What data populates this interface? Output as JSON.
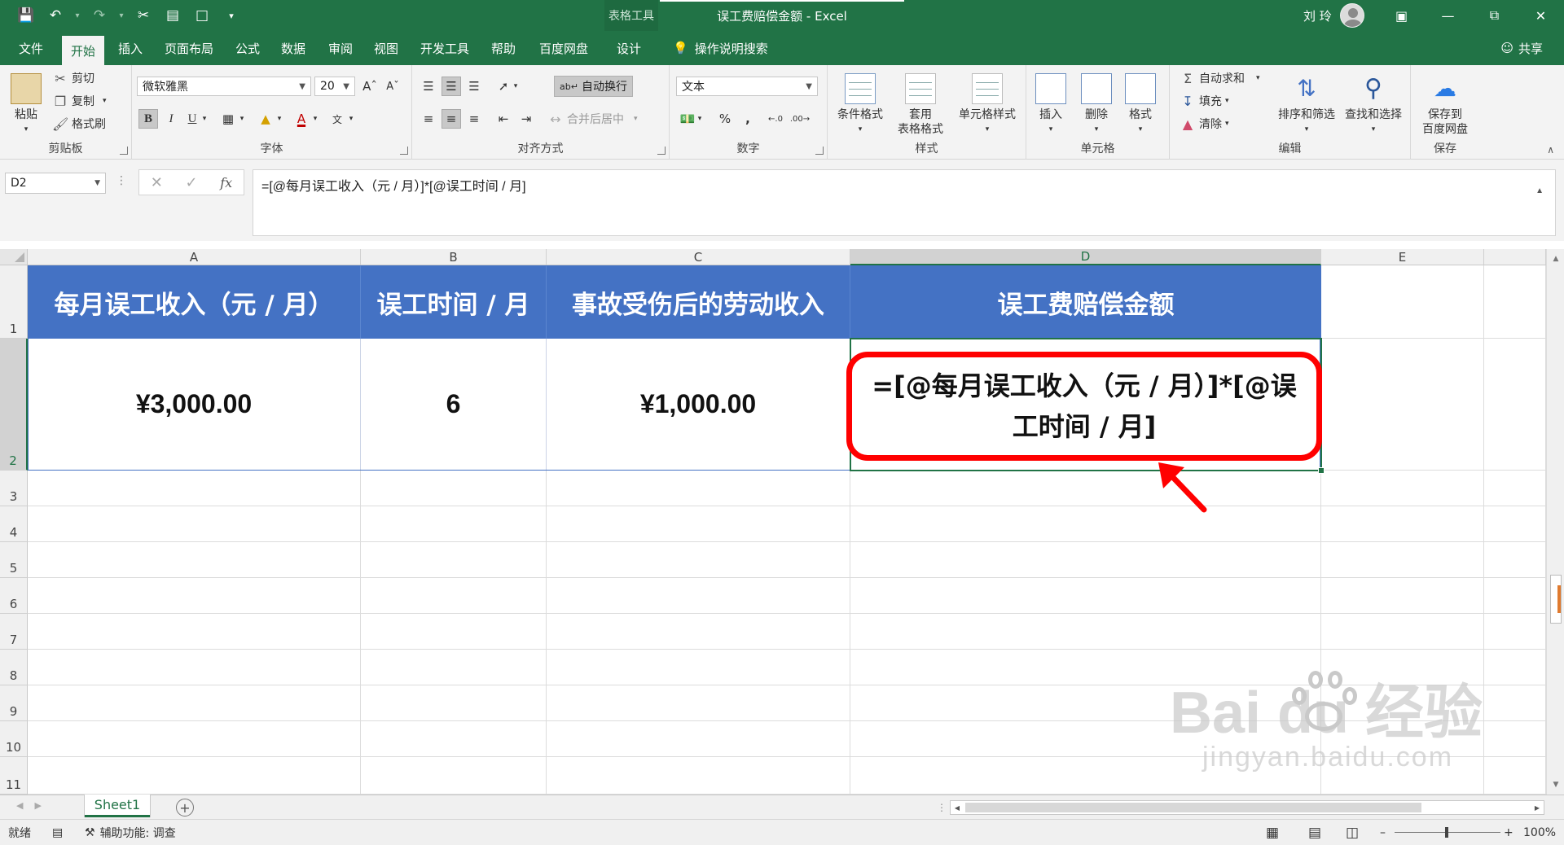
{
  "titlebar": {
    "context_tools": "表格工具",
    "title": "误工费赔偿金额 - Excel",
    "user": "刘 玲"
  },
  "tabs": [
    "文件",
    "开始",
    "插入",
    "页面布局",
    "公式",
    "数据",
    "审阅",
    "视图",
    "开发工具",
    "帮助",
    "百度网盘",
    "设计"
  ],
  "tellme": "操作说明搜索",
  "share": "共享",
  "ribbon": {
    "clipboard": {
      "paste": "粘贴",
      "cut": "剪切",
      "copy": "复制",
      "format_painter": "格式刷",
      "label": "剪贴板"
    },
    "font": {
      "name": "微软雅黑",
      "size": "20",
      "label": "字体"
    },
    "alignment": {
      "wrap": "自动换行",
      "merge": "合并后居中",
      "label": "对齐方式"
    },
    "number": {
      "format": "文本",
      "label": "数字"
    },
    "styles": {
      "conditional": "条件格式",
      "table1": "套用",
      "table2": "表格格式",
      "cell_styles": "单元格样式",
      "label": "样式"
    },
    "cells": {
      "insert": "插入",
      "delete": "删除",
      "format": "格式",
      "label": "单元格"
    },
    "editing": {
      "autosum": "自动求和",
      "fill": "填充",
      "clear": "清除",
      "sort": "排序和筛选",
      "find": "查找和选择",
      "label": "编辑"
    },
    "save": {
      "btn1": "保存到",
      "btn2": "百度网盘",
      "label": "保存"
    }
  },
  "formula_bar": {
    "name_box": "D2",
    "formula": "=[@每月误工收入（元 / 月）]*[@误工时间 / 月]"
  },
  "columns": [
    "A",
    "B",
    "C",
    "D",
    "E"
  ],
  "rows": [
    "1",
    "2",
    "3",
    "4",
    "5",
    "6",
    "7",
    "8",
    "9",
    "10",
    "11"
  ],
  "table": {
    "headers": [
      "每月误工收入（元 / 月）",
      "误工时间 / 月",
      "事故受伤后的劳动收入",
      "误工费赔偿金额"
    ],
    "row1": [
      "¥3,000.00",
      "6",
      "¥1,000.00"
    ],
    "callout": "=[@每月误工收入（元 / 月）]*[@误工时间 / 月]"
  },
  "watermark": {
    "main": "Bai du 经验",
    "sub": "jingyan.baidu.com"
  },
  "sheet_tab": "Sheet1",
  "status": {
    "ready": "就绪",
    "accessibility": "辅助功能: 调查",
    "zoom": "100%"
  },
  "colors": {
    "excel_green": "#217346",
    "table_header": "#4472c4",
    "callout": "#ff0000"
  }
}
